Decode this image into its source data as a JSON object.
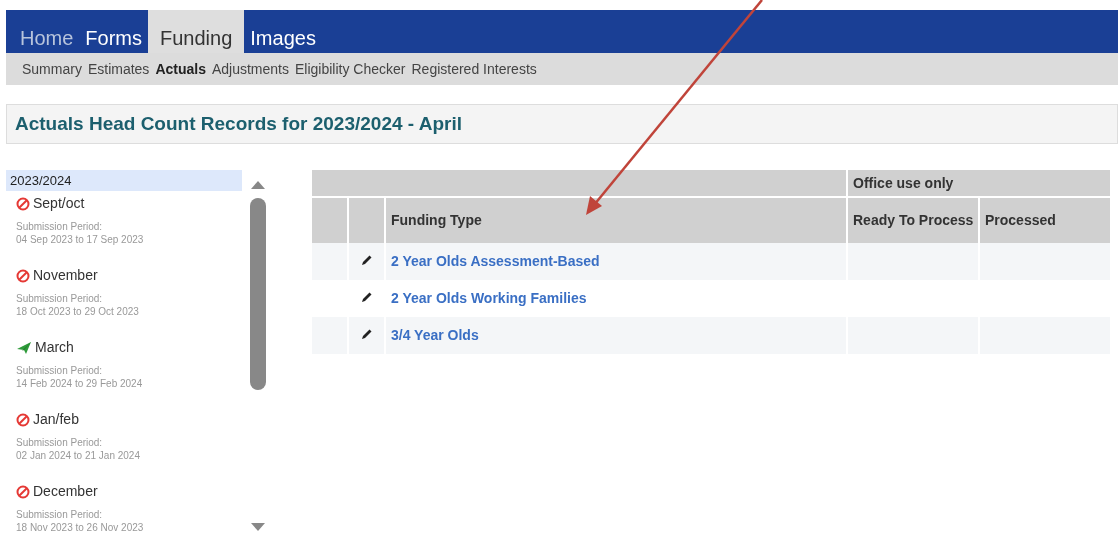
{
  "main_tabs": [
    {
      "label": "Home",
      "selected": false,
      "muted": true
    },
    {
      "label": "Forms",
      "selected": false,
      "muted": false
    },
    {
      "label": "Funding",
      "selected": true,
      "muted": false
    },
    {
      "label": "Images",
      "selected": false,
      "muted": false
    }
  ],
  "sub_tabs": [
    {
      "label": "Summary",
      "selected": false
    },
    {
      "label": "Estimates",
      "selected": false
    },
    {
      "label": "Actuals",
      "selected": true
    },
    {
      "label": "Adjustments",
      "selected": false
    },
    {
      "label": "Eligibility Checker",
      "selected": false
    },
    {
      "label": "Registered Interests",
      "selected": false
    }
  ],
  "page_title": "Actuals Head Count Records for 2023/2024 - April",
  "sidebar": {
    "year": "2023/2024",
    "items": [
      {
        "kind": "blocked",
        "name": "Sept/oct",
        "period_label": "Submission Period:",
        "period": "04 Sep 2023 to 17 Sep 2023"
      },
      {
        "kind": "blocked",
        "name": "November",
        "period_label": "Submission Period:",
        "period": "18 Oct 2023 to 29 Oct 2023"
      },
      {
        "kind": "sent",
        "name": "March",
        "period_label": "Submission Period:",
        "period": "14 Feb 2024 to 29 Feb 2024"
      },
      {
        "kind": "blocked",
        "name": "Jan/feb",
        "period_label": "Submission Period:",
        "period": "02 Jan 2024 to 21 Jan 2024"
      },
      {
        "kind": "blocked",
        "name": "December",
        "period_label": "Submission Period:",
        "period": "18 Nov 2023 to 26 Nov 2023"
      }
    ]
  },
  "table": {
    "group_heading": "Office use only",
    "columns": [
      "Funding Type",
      "Ready To Process",
      "Processed"
    ],
    "rows": [
      {
        "funding_type": "2 Year Olds Assessment-Based"
      },
      {
        "funding_type": "2 Year Olds Working Families"
      },
      {
        "funding_type": "3/4 Year Olds"
      }
    ]
  }
}
